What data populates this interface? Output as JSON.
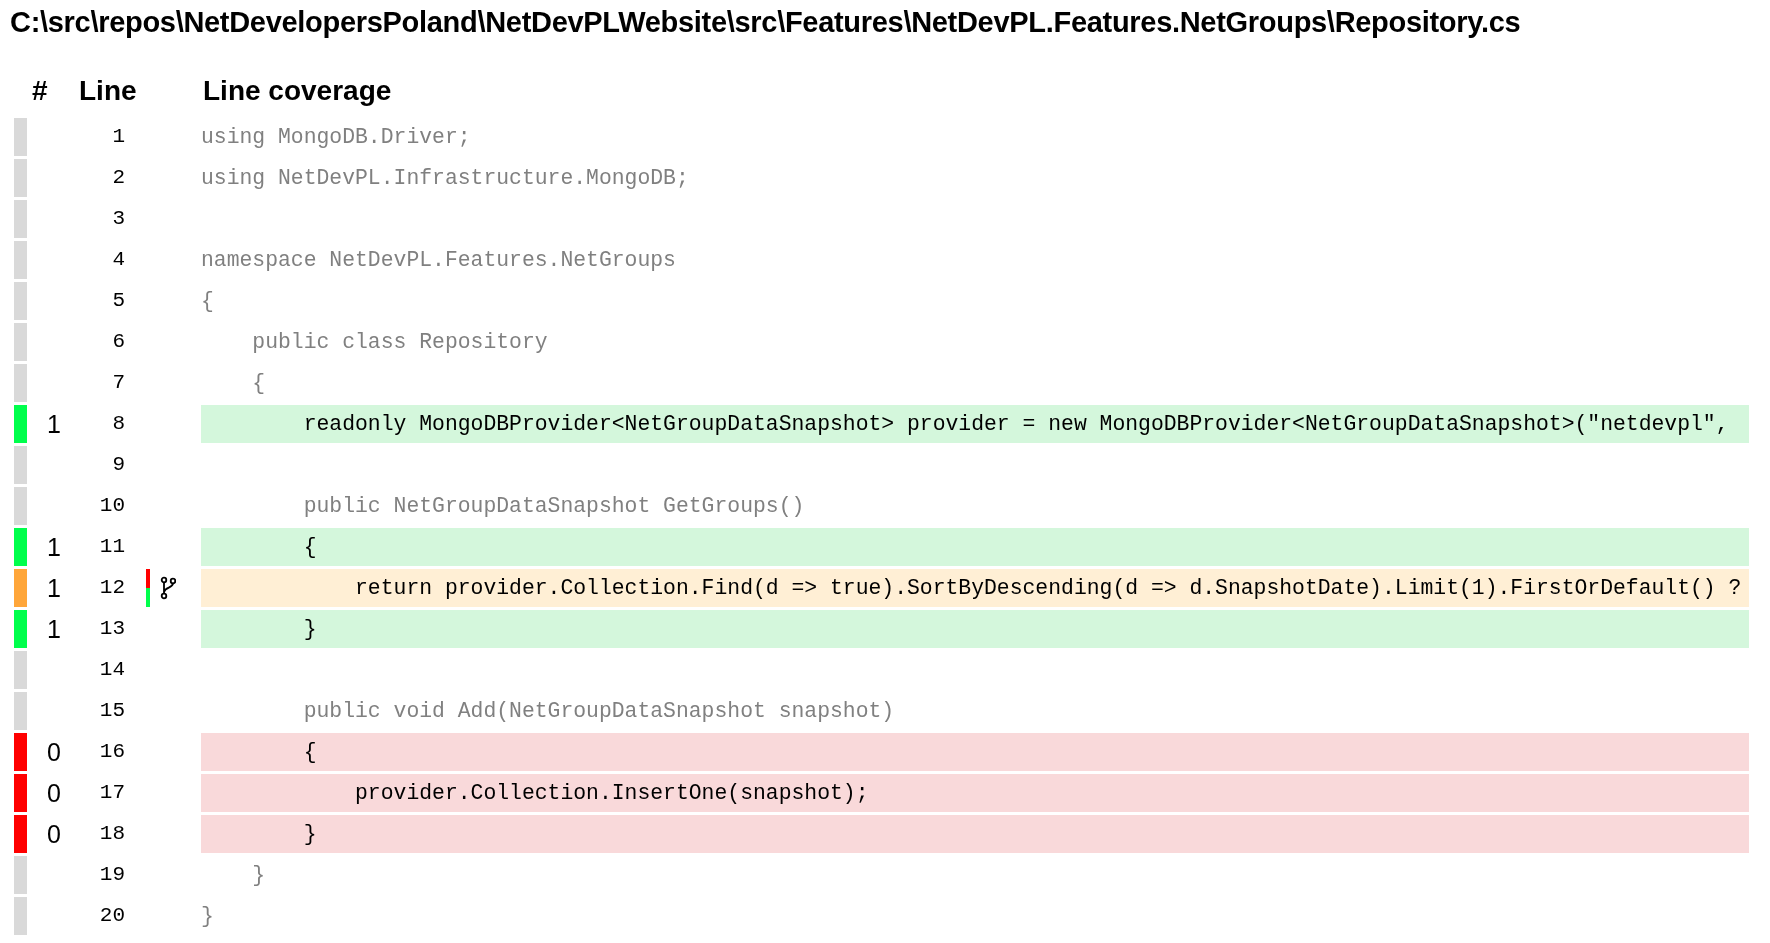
{
  "title": "C:\\src\\repos\\NetDevelopersPoland\\NetDevPLWebsite\\src\\Features\\NetDevPL.Features.NetGroups\\Repository.cs",
  "columns": [
    "#",
    "Line",
    "Line coverage"
  ],
  "rows": [
    {
      "line": "1",
      "kind": "none",
      "code": "using MongoDB.Driver;"
    },
    {
      "line": "2",
      "kind": "none",
      "code": "using NetDevPL.Infrastructure.MongoDB;"
    },
    {
      "line": "3",
      "kind": "none"
    },
    {
      "line": "4",
      "kind": "none",
      "code": "namespace NetDevPL.Features.NetGroups"
    },
    {
      "line": "5",
      "kind": "none",
      "code": "{"
    },
    {
      "line": "6",
      "kind": "none",
      "code": "    public class Repository"
    },
    {
      "line": "7",
      "kind": "none",
      "code": "    {"
    },
    {
      "line": "8",
      "count": "1",
      "kind": "covered",
      "code": "        readonly MongoDBProvider<NetGroupDataSnapshot> provider = new MongoDBProvider<NetGroupDataSnapshot>(\"netdevpl\","
    },
    {
      "line": "9",
      "kind": "none"
    },
    {
      "line": "10",
      "kind": "none",
      "code": "        public NetGroupDataSnapshot GetGroups()"
    },
    {
      "line": "11",
      "count": "1",
      "kind": "covered",
      "code": "        {"
    },
    {
      "line": "12",
      "count": "1",
      "kind": "partial",
      "code": "            return provider.Collection.Find(d => true).SortByDescending(d => d.SnapshotDate).Limit(1).FirstOrDefault() ?",
      "branches": {
        "level": 0.5
      }
    },
    {
      "line": "13",
      "count": "1",
      "kind": "covered",
      "code": "        }"
    },
    {
      "line": "14",
      "kind": "none"
    },
    {
      "line": "15",
      "kind": "none",
      "code": "        public void Add(NetGroupDataSnapshot snapshot)"
    },
    {
      "line": "16",
      "count": "0",
      "kind": "uncovered",
      "code": "        {"
    },
    {
      "line": "17",
      "count": "0",
      "kind": "uncovered",
      "code": "            provider.Collection.InsertOne(snapshot);"
    },
    {
      "line": "18",
      "count": "0",
      "kind": "uncovered",
      "code": "        }"
    },
    {
      "line": "19",
      "kind": "none",
      "code": "    }"
    },
    {
      "line": "20",
      "kind": "none",
      "code": "}"
    }
  ]
}
